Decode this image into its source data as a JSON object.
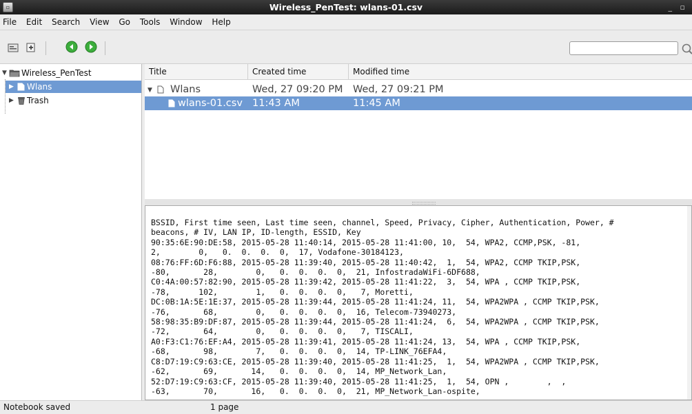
{
  "window": {
    "title": "Wireless_PenTest: wlans-01.csv",
    "controls": "_ ▫"
  },
  "menu": [
    "File",
    "Edit",
    "Search",
    "View",
    "Go",
    "Tools",
    "Window",
    "Help"
  ],
  "toolbar": {
    "search_placeholder": "",
    "search_value": ""
  },
  "tree": {
    "root": "Wireless_PenTest",
    "items": [
      {
        "label": "Wlans",
        "selected": true
      },
      {
        "label": "Trash",
        "selected": false
      }
    ]
  },
  "list": {
    "columns": [
      "Title",
      "Created time",
      "Modified time"
    ],
    "rows": [
      {
        "title": "Wlans",
        "created": "Wed, 27 09:20 PM",
        "modified": "Wed, 27 09:21 PM",
        "selected": false
      },
      {
        "title": "wlans-01.csv",
        "created": "11:43 AM",
        "modified": "11:45 AM",
        "selected": true
      }
    ]
  },
  "editor": {
    "lines": [
      "BSSID, First time seen, Last time seen, channel, Speed, Privacy, Cipher, Authentication, Power, #",
      "beacons, # IV, LAN IP, ID-length, ESSID, Key",
      "90:35:6E:90:DE:58, 2015-05-28 11:40:14, 2015-05-28 11:41:00, 10,  54, WPA2, CCMP,PSK, -81,",
      "2,        0,   0.  0.  0.  0,  17, Vodafone-30184123,",
      "08:76:FF:6D:F6:88, 2015-05-28 11:39:40, 2015-05-28 11:40:42,  1,  54, WPA2, CCMP TKIP,PSK,",
      "-80,       28,        0,   0.  0.  0.  0,  21, InfostradaWiFi-6DF688,",
      "C0:4A:00:57:82:90, 2015-05-28 11:39:42, 2015-05-28 11:41:22,  3,  54, WPA , CCMP TKIP,PSK,",
      "-78,      102,        1,   0.  0.  0.  0,   7, Moretti,",
      "DC:0B:1A:5E:1E:37, 2015-05-28 11:39:44, 2015-05-28 11:41:24, 11,  54, WPA2WPA , CCMP TKIP,PSK,",
      "-76,       68,        0,   0.  0.  0.  0,  16, Telecom-73940273,",
      "58:98:35:B9:DF:87, 2015-05-28 11:39:44, 2015-05-28 11:41:24,  6,  54, WPA2WPA , CCMP TKIP,PSK,",
      "-72,       64,        0,   0.  0.  0.  0,   7, TISCALI,",
      "A0:F3:C1:76:EF:A4, 2015-05-28 11:39:41, 2015-05-28 11:41:24, 13,  54, WPA , CCMP TKIP,PSK,",
      "-68,       98,        7,   0.  0.  0.  0,  14, TP-LINK_76EFA4,",
      "C8:D7:19:C9:63:CE, 2015-05-28 11:39:40, 2015-05-28 11:41:25,  1,  54, WPA2WPA , CCMP TKIP,PSK,",
      "-62,       69,       14,   0.  0.  0.  0,  14, MP_Network_Lan,",
      "52:D7:19:C9:63:CF, 2015-05-28 11:39:40, 2015-05-28 11:41:25,  1,  54, OPN ,        ,  ,",
      "-63,       70,       16,   0.  0.  0.  0,  21, MP_Network_Lan-ospite,"
    ]
  },
  "status": {
    "message": "Notebook saved",
    "pages": "1 page"
  },
  "colors": {
    "selection": "#6e9ad3",
    "green_nav": "#3cae3c"
  }
}
